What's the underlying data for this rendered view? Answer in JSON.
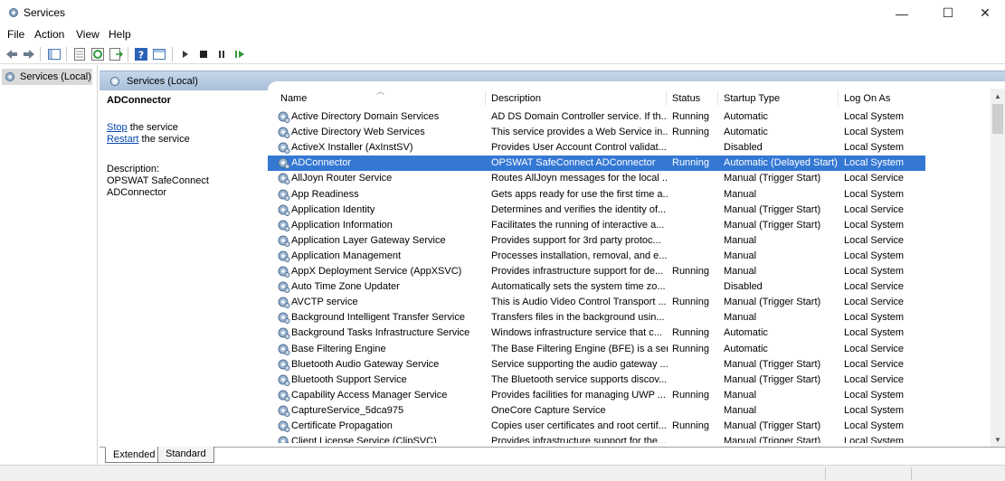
{
  "window": {
    "title": "Services",
    "minimize_glyph": "—",
    "maximize_glyph": "☐",
    "close_glyph": "✕"
  },
  "menu": [
    "File",
    "Action",
    "View",
    "Help"
  ],
  "toolbar": {
    "icons": [
      "back-icon",
      "forward-icon",
      "show-hide-tree-icon",
      "properties-icon",
      "refresh-icon",
      "export-list-icon",
      "help-icon",
      "console-tree-icon",
      "start-icon",
      "stop-icon",
      "pause-icon",
      "resume-icon"
    ]
  },
  "tree": {
    "selected_label": "Services (Local)"
  },
  "main": {
    "header_title": "Services (Local)",
    "selected_service": "ADConnector",
    "stop_link": "Stop",
    "stop_suffix": " the service",
    "restart_link": "Restart",
    "restart_suffix": " the service",
    "description_label": "Description:",
    "description_text": "OPSWAT SafeConnect ADConnector"
  },
  "columns": {
    "name": "Name",
    "description": "Description",
    "status": "Status",
    "startup_type": "Startup Type",
    "log_on_as": "Log On As"
  },
  "services": [
    {
      "name": "Active Directory Domain Services",
      "description": "AD DS Domain Controller service. If th...",
      "status": "Running",
      "startup": "Automatic",
      "logon": "Local System"
    },
    {
      "name": "Active Directory Web Services",
      "description": "This service provides a Web Service in...",
      "status": "Running",
      "startup": "Automatic",
      "logon": "Local System"
    },
    {
      "name": "ActiveX Installer (AxInstSV)",
      "description": "Provides User Account Control validat...",
      "status": "",
      "startup": "Disabled",
      "logon": "Local System"
    },
    {
      "name": "ADConnector",
      "description": "OPSWAT SafeConnect ADConnector",
      "status": "Running",
      "startup": "Automatic (Delayed Start)",
      "logon": "Local System"
    },
    {
      "name": "AllJoyn Router Service",
      "description": "Routes AllJoyn messages for the local ...",
      "status": "",
      "startup": "Manual (Trigger Start)",
      "logon": "Local Service"
    },
    {
      "name": "App Readiness",
      "description": "Gets apps ready for use the first time a...",
      "status": "",
      "startup": "Manual",
      "logon": "Local System"
    },
    {
      "name": "Application Identity",
      "description": "Determines and verifies the identity of...",
      "status": "",
      "startup": "Manual (Trigger Start)",
      "logon": "Local Service"
    },
    {
      "name": "Application Information",
      "description": "Facilitates the running of interactive a...",
      "status": "",
      "startup": "Manual (Trigger Start)",
      "logon": "Local System"
    },
    {
      "name": "Application Layer Gateway Service",
      "description": "Provides support for 3rd party protoc...",
      "status": "",
      "startup": "Manual",
      "logon": "Local Service"
    },
    {
      "name": "Application Management",
      "description": "Processes installation, removal, and e...",
      "status": "",
      "startup": "Manual",
      "logon": "Local System"
    },
    {
      "name": "AppX Deployment Service (AppXSVC)",
      "description": "Provides infrastructure support for de...",
      "status": "Running",
      "startup": "Manual",
      "logon": "Local System"
    },
    {
      "name": "Auto Time Zone Updater",
      "description": "Automatically sets the system time zo...",
      "status": "",
      "startup": "Disabled",
      "logon": "Local Service"
    },
    {
      "name": "AVCTP service",
      "description": "This is Audio Video Control Transport ...",
      "status": "Running",
      "startup": "Manual (Trigger Start)",
      "logon": "Local Service"
    },
    {
      "name": "Background Intelligent Transfer Service",
      "description": "Transfers files in the background usin...",
      "status": "",
      "startup": "Manual",
      "logon": "Local System"
    },
    {
      "name": "Background Tasks Infrastructure Service",
      "description": "Windows infrastructure service that c...",
      "status": "Running",
      "startup": "Automatic",
      "logon": "Local System"
    },
    {
      "name": "Base Filtering Engine",
      "description": "The Base Filtering Engine (BFE) is a ser...",
      "status": "Running",
      "startup": "Automatic",
      "logon": "Local Service"
    },
    {
      "name": "Bluetooth Audio Gateway Service",
      "description": "Service supporting the audio gateway ...",
      "status": "",
      "startup": "Manual (Trigger Start)",
      "logon": "Local Service"
    },
    {
      "name": "Bluetooth Support Service",
      "description": "The Bluetooth service supports discov...",
      "status": "",
      "startup": "Manual (Trigger Start)",
      "logon": "Local Service"
    },
    {
      "name": "Capability Access Manager Service",
      "description": "Provides facilities for managing UWP ...",
      "status": "Running",
      "startup": "Manual",
      "logon": "Local System"
    },
    {
      "name": "CaptureService_5dca975",
      "description": "OneCore Capture Service",
      "status": "",
      "startup": "Manual",
      "logon": "Local System"
    },
    {
      "name": "Certificate Propagation",
      "description": "Copies user certificates and root certif...",
      "status": "Running",
      "startup": "Manual (Trigger Start)",
      "logon": "Local System"
    },
    {
      "name": "Client License Service (ClipSVC)",
      "description": "Provides infrastructure support for the...",
      "status": "",
      "startup": "Manual (Trigger Start)",
      "logon": "Local System"
    }
  ],
  "selected_index": 3,
  "tabs": [
    "Extended",
    "Standard"
  ]
}
